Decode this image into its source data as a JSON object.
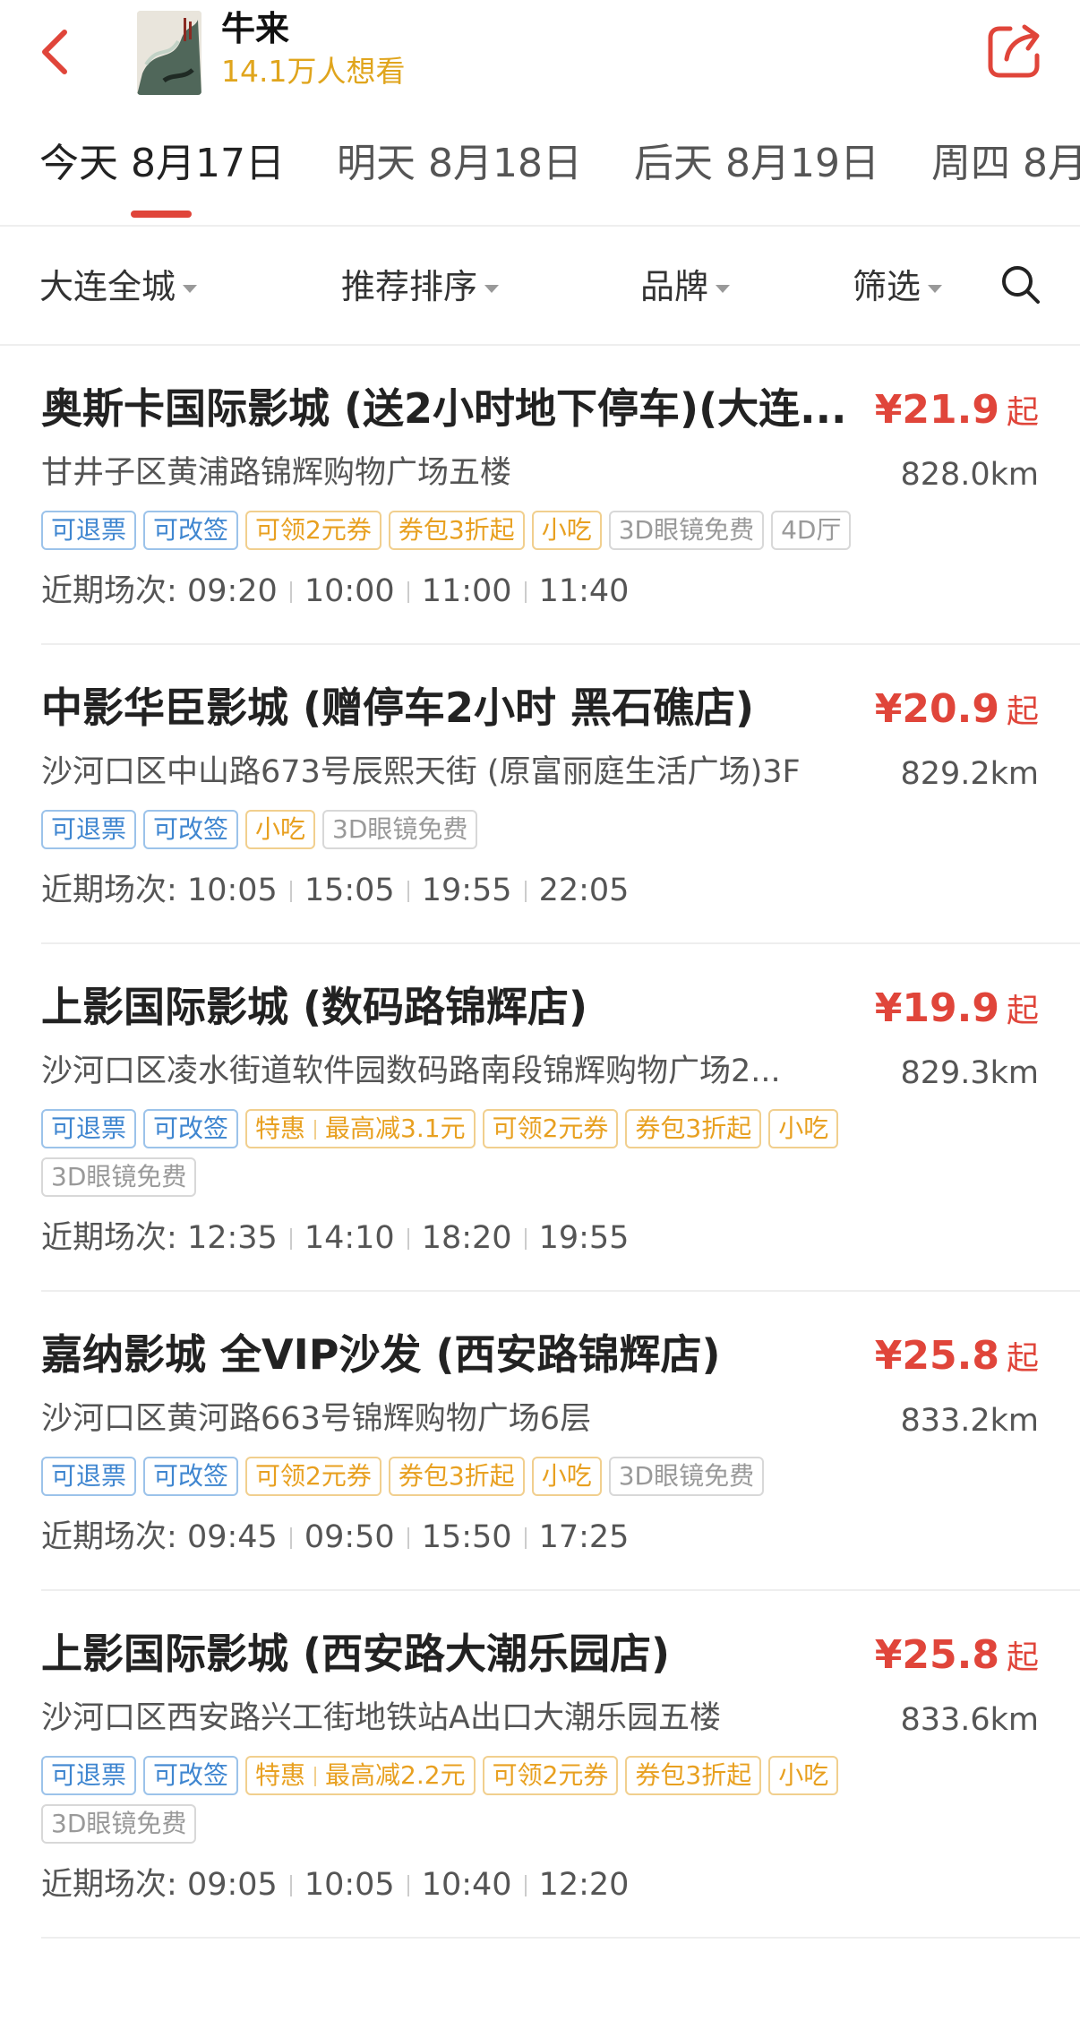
{
  "header": {
    "movie_title": "牛来",
    "want_count": "14.1万人想看"
  },
  "date_tabs": [
    {
      "label": "今天 8月17日",
      "active": true
    },
    {
      "label": "明天 8月18日",
      "active": false
    },
    {
      "label": "后天 8月19日",
      "active": false
    },
    {
      "label": "周四 8月",
      "active": false
    }
  ],
  "filters": {
    "city": "大连全城",
    "sort": "推荐排序",
    "brand": "品牌",
    "filter": "筛选"
  },
  "cinemas": [
    {
      "name": "奥斯卡国际影城 (送2小时地下停车)(大连...",
      "price": "¥21.9",
      "price_suffix": "起",
      "address": "甘井子区黄浦路锦辉购物广场五楼",
      "distance": "828.0km",
      "tags": [
        {
          "text": "可退票",
          "style": "blue"
        },
        {
          "text": "可改签",
          "style": "blue"
        },
        {
          "text": "可领2元券",
          "style": "orange"
        },
        {
          "text": "券包3折起",
          "style": "orange"
        },
        {
          "text": "小吃",
          "style": "orange"
        },
        {
          "text": "3D眼镜免费",
          "style": "gray"
        },
        {
          "text": "4D厅",
          "style": "gray"
        }
      ],
      "showtimes_label": "近期场次:",
      "showtimes": [
        "09:20",
        "10:00",
        "11:00",
        "11:40"
      ]
    },
    {
      "name": "中影华臣影城 (赠停车2小时 黑石礁店)",
      "price": "¥20.9",
      "price_suffix": "起",
      "address": "沙河口区中山路673号辰熙天街 (原富丽庭生活广场)3F",
      "distance": "829.2km",
      "tags": [
        {
          "text": "可退票",
          "style": "blue"
        },
        {
          "text": "可改签",
          "style": "blue"
        },
        {
          "text": "小吃",
          "style": "orange"
        },
        {
          "text": "3D眼镜免费",
          "style": "gray"
        }
      ],
      "showtimes_label": "近期场次:",
      "showtimes": [
        "10:05",
        "15:05",
        "19:55",
        "22:05"
      ]
    },
    {
      "name": "上影国际影城 (数码路锦辉店)",
      "price": "¥19.9",
      "price_suffix": "起",
      "address": "沙河口区凌水街道软件园数码路南段锦辉购物广场2...",
      "distance": "829.3km",
      "tags": [
        {
          "text": "可退票",
          "style": "blue"
        },
        {
          "text": "可改签",
          "style": "blue"
        },
        {
          "text": "特惠",
          "text2": "最高减3.1元",
          "style": "orange"
        },
        {
          "text": "可领2元券",
          "style": "orange"
        },
        {
          "text": "券包3折起",
          "style": "orange"
        },
        {
          "text": "小吃",
          "style": "orange"
        },
        {
          "text": "3D眼镜免费",
          "style": "gray"
        }
      ],
      "showtimes_label": "近期场次:",
      "showtimes": [
        "12:35",
        "14:10",
        "18:20",
        "19:55"
      ]
    },
    {
      "name": "嘉纳影城 全VIP沙发 (西安路锦辉店)",
      "price": "¥25.8",
      "price_suffix": "起",
      "address": "沙河口区黄河路663号锦辉购物广场6层",
      "distance": "833.2km",
      "tags": [
        {
          "text": "可退票",
          "style": "blue"
        },
        {
          "text": "可改签",
          "style": "blue"
        },
        {
          "text": "可领2元券",
          "style": "orange"
        },
        {
          "text": "券包3折起",
          "style": "orange"
        },
        {
          "text": "小吃",
          "style": "orange"
        },
        {
          "text": "3D眼镜免费",
          "style": "gray"
        }
      ],
      "showtimes_label": "近期场次:",
      "showtimes": [
        "09:45",
        "09:50",
        "15:50",
        "17:25"
      ]
    },
    {
      "name": "上影国际影城 (西安路大潮乐园店)",
      "price": "¥25.8",
      "price_suffix": "起",
      "address": "沙河口区西安路兴工街地铁站A出口大潮乐园五楼",
      "distance": "833.6km",
      "tags": [
        {
          "text": "可退票",
          "style": "blue"
        },
        {
          "text": "可改签",
          "style": "blue"
        },
        {
          "text": "特惠",
          "text2": "最高减2.2元",
          "style": "orange"
        },
        {
          "text": "可领2元券",
          "style": "orange"
        },
        {
          "text": "券包3折起",
          "style": "orange"
        },
        {
          "text": "小吃",
          "style": "orange"
        },
        {
          "text": "3D眼镜免费",
          "style": "gray"
        }
      ],
      "showtimes_label": "近期场次:",
      "showtimes": [
        "09:05",
        "10:05",
        "10:40",
        "12:20"
      ]
    }
  ],
  "colors": {
    "accent": "#e0453a",
    "want_count": "#e0a51d",
    "tag_blue": "#3f86d0",
    "tag_orange": "#e8a020",
    "tag_gray": "#999999"
  },
  "icons": {
    "back": "back-arrow-icon",
    "share": "share-icon",
    "search": "search-icon",
    "dropdown": "caret-down-icon"
  }
}
